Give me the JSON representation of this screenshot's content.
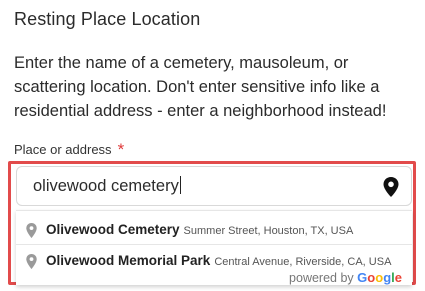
{
  "section": {
    "title": "Resting Place Location",
    "description": "Enter the name of a cemetery, mausoleum, or scattering location. Don't enter sensitive info like a residential address - enter a neighborhood instead!"
  },
  "field": {
    "label": "Place or address",
    "required_marker": "*",
    "value": "olivewood cemetery",
    "trailing_icon": "map-pin-icon"
  },
  "suggestions": [
    {
      "icon": "map-pin-icon",
      "name": "Olivewood Cemetery",
      "address": "Summer Street, Houston, TX, USA"
    },
    {
      "icon": "map-pin-icon",
      "name": "Olivewood Memorial Park",
      "address": "Central Avenue, Riverside, CA, USA"
    }
  ],
  "attribution": {
    "prefix": "powered by",
    "logo_text": "Google",
    "logo_colors": [
      "#4285F4",
      "#EA4335",
      "#FBBC05",
      "#4285F4",
      "#34A853",
      "#EA4335"
    ]
  },
  "colors": {
    "highlight_border": "#e24b4b",
    "required": "#e03a3a",
    "text": "#2b2b2b"
  }
}
